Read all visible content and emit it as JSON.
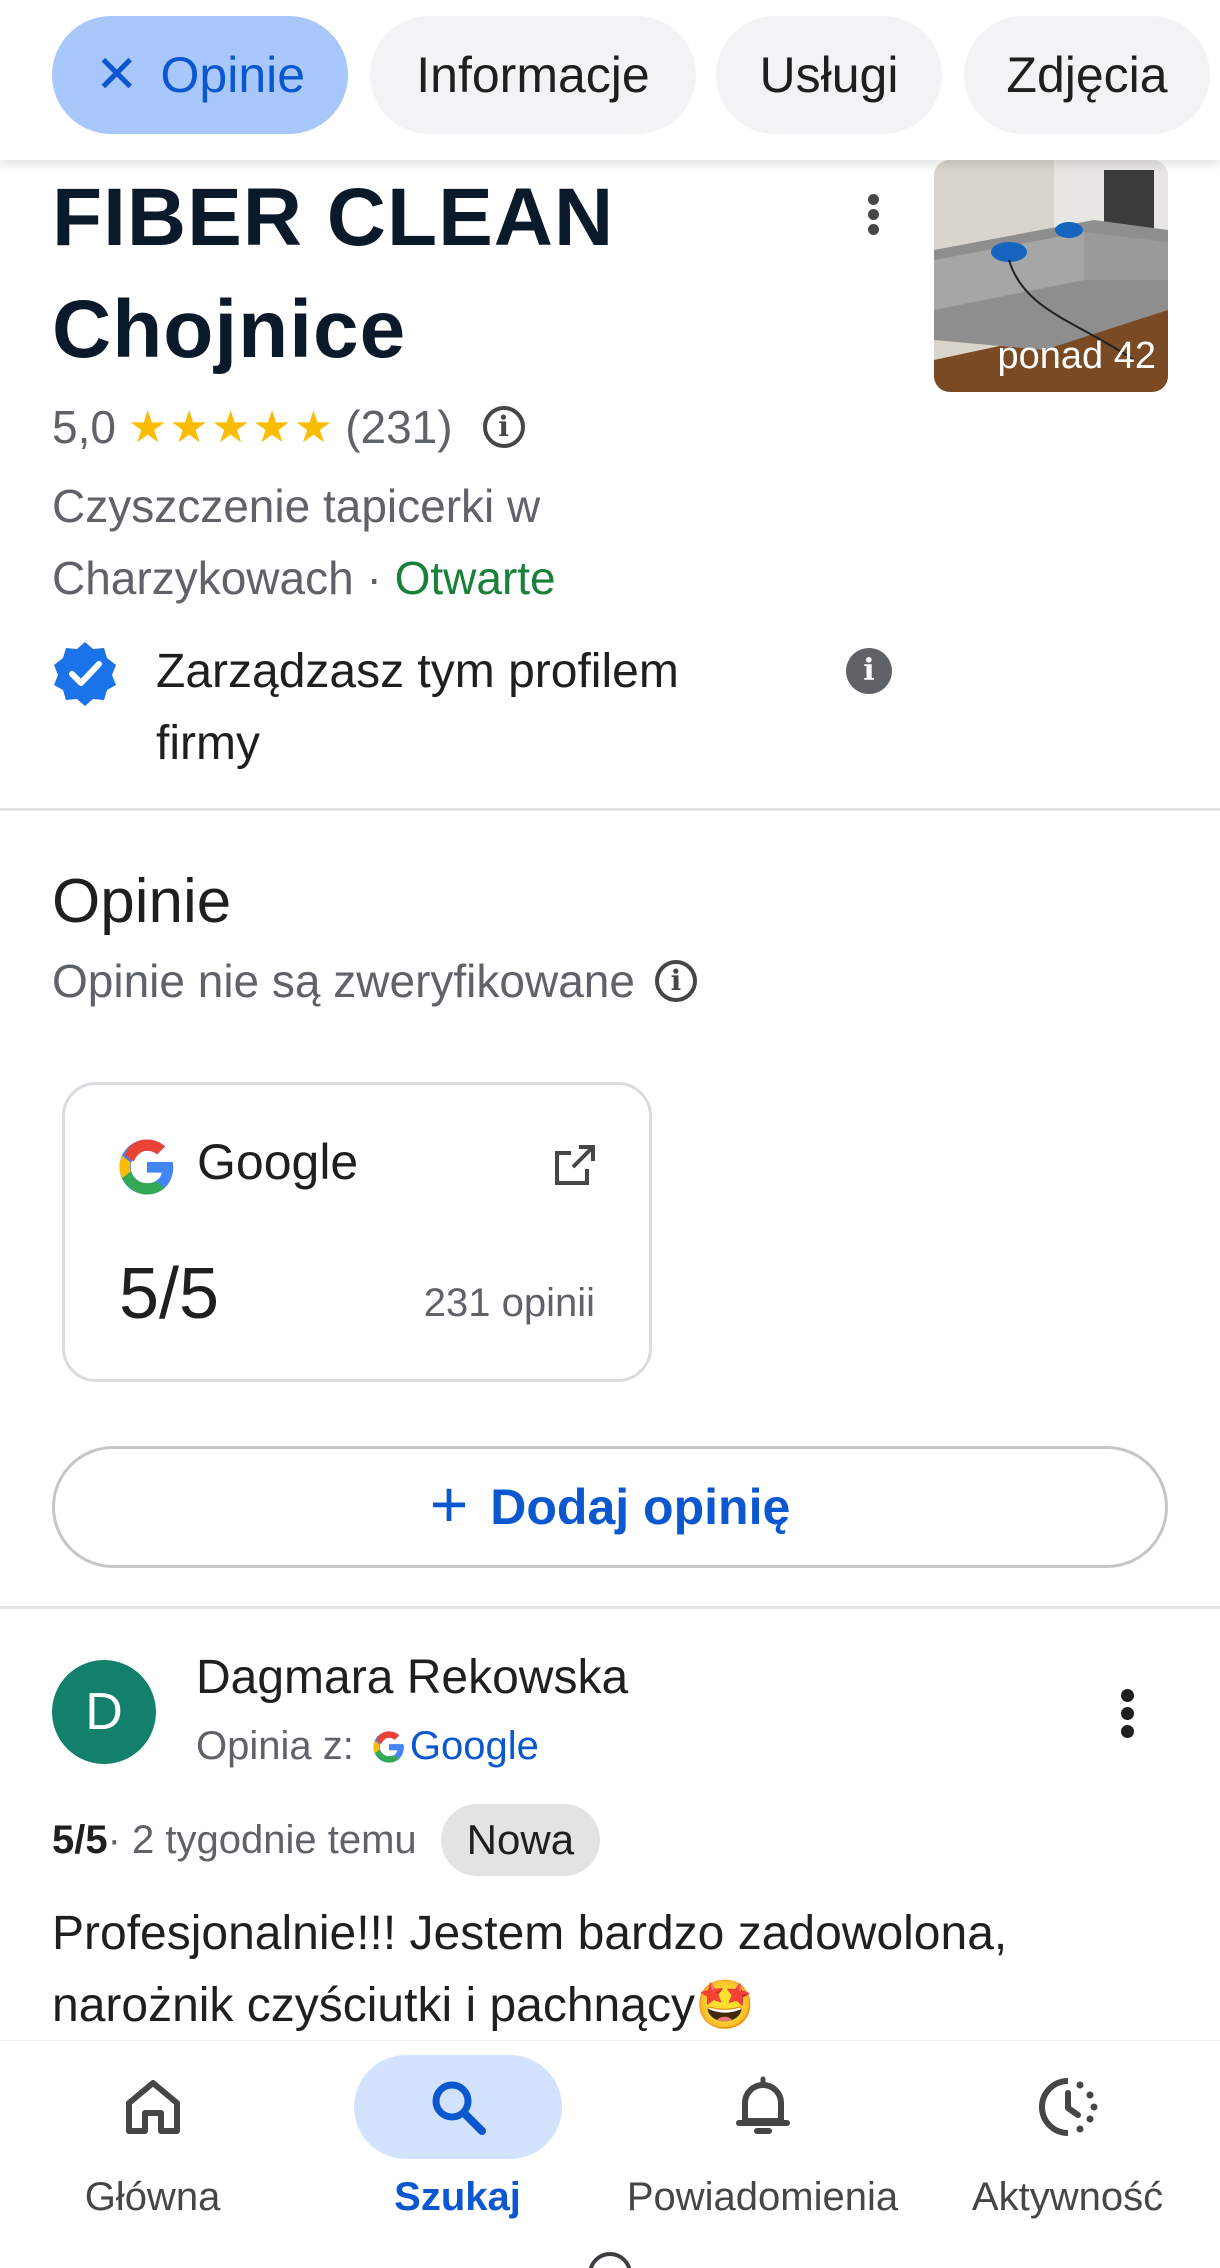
{
  "chips": [
    {
      "label": "Opinie",
      "active": true,
      "close_icon": "close-icon"
    },
    {
      "label": "Informacje",
      "active": false
    },
    {
      "label": "Usługi",
      "active": false
    },
    {
      "label": "Zdjęcia",
      "active": false
    }
  ],
  "business": {
    "name_line1": "FIBER CLEAN",
    "name_line2": "Chojnice",
    "rating": "5,0",
    "stars": "★★★★★",
    "review_count": "(231)",
    "category": "Czyszczenie tapicerki w Charzykowach",
    "separator": " · ",
    "status": "Otwarte",
    "photo_label": "ponad 42",
    "manage_text": "Zarządzasz tym profilem firmy"
  },
  "reviews_section": {
    "title": "Opinie",
    "subtitle": "Opinie nie są zweryfikowane",
    "source_card": {
      "source_name": "Google",
      "score": "5/5",
      "count_label": "231 opinii"
    },
    "add_review_label": "Dodaj opinię"
  },
  "review": {
    "avatar_letter": "D",
    "author": "Dagmara Rekowska",
    "source_prefix": "Opinia z:",
    "source_name": "Google",
    "score": "5/5",
    "time": " · 2 tygodnie temu",
    "badge": "Nowa",
    "text": "Profesjonalnie!!! Jestem bardzo zadowolona, narożnik czyściutki i pachnący🤩"
  },
  "bottom_nav": [
    {
      "label": "Główna",
      "icon": "home-icon",
      "active": false
    },
    {
      "label": "Szukaj",
      "icon": "search-icon",
      "active": true
    },
    {
      "label": "Powiadomienia",
      "icon": "bell-icon",
      "active": false
    },
    {
      "label": "Aktywność",
      "icon": "activity-icon",
      "active": false
    }
  ],
  "colors": {
    "accent": "#0b57d0",
    "chip_active_bg": "#a8c7fa",
    "star": "#fbbc04",
    "open_green": "#188038",
    "avatar_bg": "#12806a"
  }
}
